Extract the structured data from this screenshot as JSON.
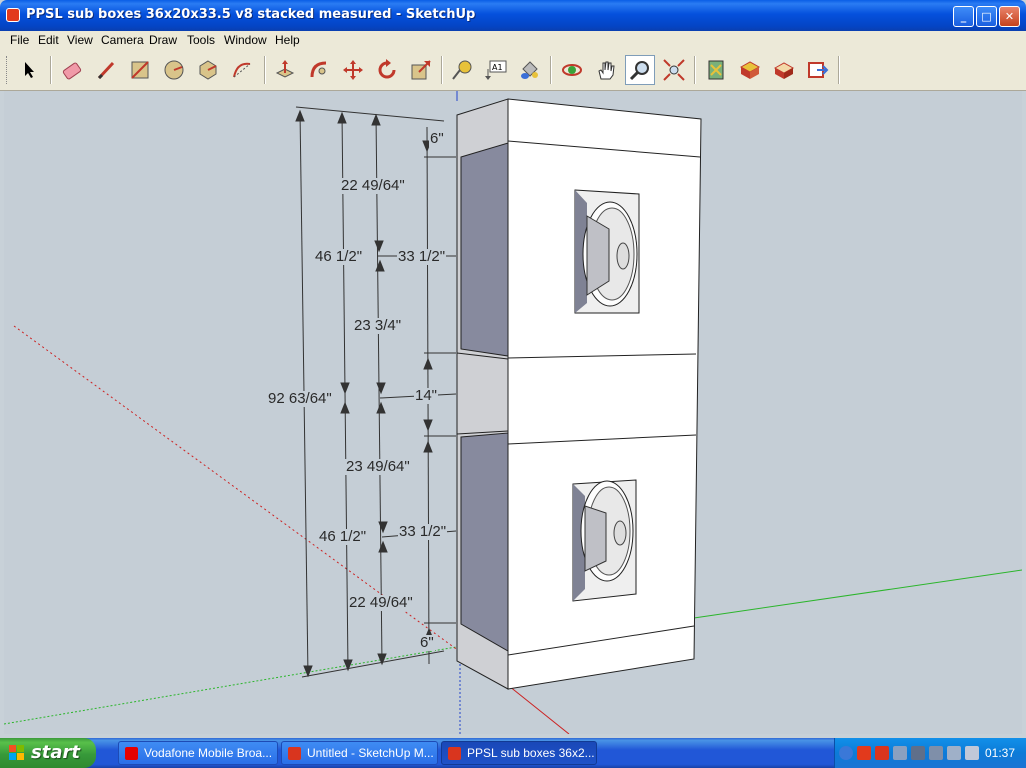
{
  "window": {
    "title": "PPSL sub boxes 36x20x33.5 v8 stacked measured - SketchUp",
    "minimize": "_",
    "maximize": "□",
    "close": "✕"
  },
  "menu": [
    "File",
    "Edit",
    "View",
    "Camera",
    "Draw",
    "Tools",
    "Window",
    "Help"
  ],
  "toolbar": {
    "tools": [
      "select-tool",
      "eraser-tool",
      "pencil-tool",
      "rectangle-tool",
      "circle-tool",
      "polygon-tool",
      "arc-tool",
      "push-pull-tool",
      "follow-me-tool",
      "move-tool",
      "rotate-tool",
      "scale-tool",
      "tape-measure-tool",
      "text-tool",
      "paint-bucket-tool",
      "orbit-tool",
      "pan-tool",
      "zoom-tool",
      "zoom-extents-tool",
      "previous-view-tool",
      "get-models-tool",
      "share-model-tool",
      "google-earth-tool",
      "export-tool"
    ],
    "text_tool_label": "A1"
  },
  "dimensions": {
    "d1": "6\"",
    "d2": "22 49/64\"",
    "d3": "46 1/2\"",
    "d4": "33 1/2\"",
    "d5": "23 3/4\"",
    "d6": "92 63/64\"",
    "d7": "14\"",
    "d8": "23 49/64\"",
    "d9": "46 1/2\"",
    "d10": "33 1/2\"",
    "d11": "22 49/64\"",
    "d12": "6\""
  },
  "colors": {
    "box_face": "#ffffff",
    "box_side": "#cfd0d4",
    "cavity": "#878a9e",
    "viewport_bg": "#c5ced6",
    "axis_green": "#2bb52b",
    "axis_red": "#cc2222",
    "axis_blue": "#2244cc"
  },
  "taskbar": {
    "start_label": "start",
    "tasks": [
      {
        "label": "Vodafone Mobile Broa...",
        "icon": "vodafone-icon"
      },
      {
        "label": "Untitled - SketchUp M...",
        "icon": "sketchup-icon"
      },
      {
        "label": "PPSL sub boxes 36x2...",
        "icon": "sketchup-icon"
      }
    ],
    "clock": "01:37"
  }
}
